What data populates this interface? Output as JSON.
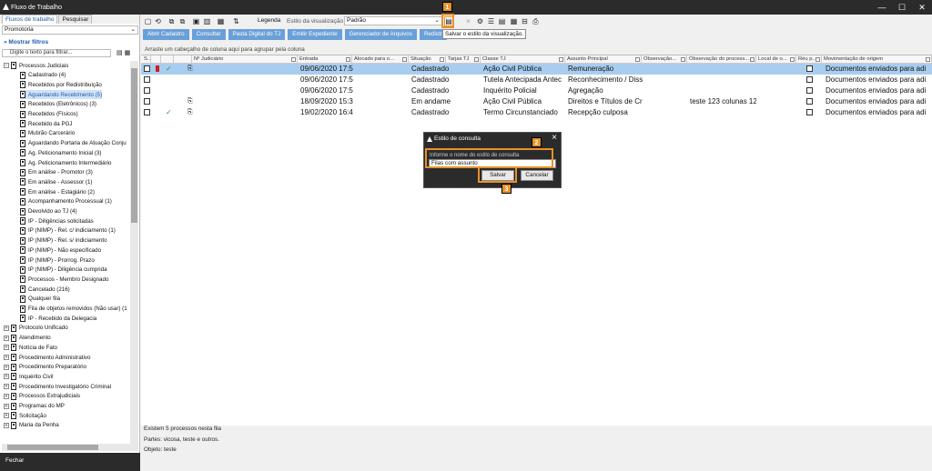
{
  "window": {
    "title": "Fluxo de Trabalho",
    "controls": [
      "—",
      "☐",
      "✕"
    ]
  },
  "left": {
    "tabs": [
      "Fluxos de trabalho",
      "Pesquisar"
    ],
    "combo_value": "Promotoria",
    "mostrar_filtros": "Mostrar filtros",
    "filter_placeholder": "Digite o texto para filtrar...",
    "tree": [
      {
        "label": "Processos Judiciais",
        "level": 0,
        "exp": "−"
      },
      {
        "label": "Cadastrado (4)",
        "level": 1
      },
      {
        "label": "Recebidos por Redistribuição",
        "level": 1
      },
      {
        "label": "Aguardando Recebimento (5)",
        "level": 1,
        "selected": true
      },
      {
        "label": "Recebidos (Eletrônicos) (3)",
        "level": 1
      },
      {
        "label": "Recebidos (Físicos)",
        "level": 1
      },
      {
        "label": "Recebido da PGJ",
        "level": 1
      },
      {
        "label": "Mutirão Carcerário",
        "level": 1
      },
      {
        "label": "Aguardando Portaria de Atuação Conju",
        "level": 1
      },
      {
        "label": "Ag. Peticionamento Inicial (3)",
        "level": 1
      },
      {
        "label": "Ag. Peticionamento Intermediário",
        "level": 1
      },
      {
        "label": "Em análise - Promotor (3)",
        "level": 1
      },
      {
        "label": "Em análise - Assessor (1)",
        "level": 1
      },
      {
        "label": "Em análise - Estagiário (2)",
        "level": 1
      },
      {
        "label": "Acompanhamento Processual (1)",
        "level": 1
      },
      {
        "label": "Devolvido ao TJ (4)",
        "level": 1
      },
      {
        "label": "IP - Diligências solicitadas",
        "level": 1
      },
      {
        "label": "IP (NIMP) - Rel. c/ indiciamento (1)",
        "level": 1
      },
      {
        "label": "IP (NIMP) - Rel. s/ indiciamento",
        "level": 1
      },
      {
        "label": "IP (NIMP) - Não especificado",
        "level": 1
      },
      {
        "label": "IP (NIMP) - Prorrog. Prazo",
        "level": 1
      },
      {
        "label": "IP (NIMP) - Diligência cumprida",
        "level": 1
      },
      {
        "label": "Processos - Membro Designado",
        "level": 1
      },
      {
        "label": "Cancelado (216)",
        "level": 1
      },
      {
        "label": "Qualquer fila",
        "level": 1
      },
      {
        "label": "Fila de objetos removidos (Não usar) (1",
        "level": 1
      },
      {
        "label": "IP - Recebido da Delegacia",
        "level": 1
      },
      {
        "label": "Protocolo Unificado",
        "level": 0,
        "exp": "+"
      },
      {
        "label": "Atendimento",
        "level": 0,
        "exp": "+"
      },
      {
        "label": "Notícia de Fato",
        "level": 0,
        "exp": "+"
      },
      {
        "label": "Procedimento Administrativo",
        "level": 0,
        "exp": "+"
      },
      {
        "label": "Procedimento Preparatório",
        "level": 0,
        "exp": "+"
      },
      {
        "label": "Inquérito Civil",
        "level": 0,
        "exp": "+"
      },
      {
        "label": "Procedimento Investigatório Criminal",
        "level": 0,
        "exp": "+"
      },
      {
        "label": "Processos Extrajudiciais",
        "level": 0,
        "exp": "+"
      },
      {
        "label": "Programas do MP",
        "level": 0,
        "exp": "+"
      },
      {
        "label": "Solicitação",
        "level": 0,
        "exp": "+"
      },
      {
        "label": "Maria da Penha",
        "level": 0,
        "exp": "+"
      }
    ],
    "fechar": "Fechar"
  },
  "toolbar": {
    "legenda": "Legenda",
    "estilo_label": "Estilo da visualização",
    "estilo_value": "Padrão",
    "tooltip": "Salvar o estilo da visualização."
  },
  "actions": [
    "Abrir Cadastro",
    "Consultar",
    "Pasta Digital do TJ",
    "Emitir Expediente",
    "Gerenciador de Arquivos",
    "Redistr"
  ],
  "grid": {
    "group_hint": "Arraste um cabeçalho de coluna aqui para agrupar pela coluna",
    "headers": [
      "S...",
      "",
      "",
      "",
      "Nº Judiciário",
      "Entrada",
      "Alocado para o...",
      "Situação",
      "Tarjas TJ",
      "Classe TJ",
      "Assunto Principal",
      "Observação...",
      "Observação do process...",
      "Local de o...",
      "Réu p...",
      "Movimentação de origem"
    ],
    "rows": [
      {
        "entrada": "09/06/2020 17:5",
        "situacao": "Cadastrado",
        "classe": "Ação Civil Pública",
        "assunto": "Remuneração",
        "obs": "",
        "mov": "Documentos enviados para adi",
        "selected": true,
        "flag": true,
        "check": true,
        "clip": true
      },
      {
        "entrada": "09/06/2020 17:5",
        "situacao": "Cadastrado",
        "classe": "Tutela Antecipada Antec",
        "assunto": "Reconhecimento / Diss",
        "obs": "",
        "mov": "Documentos enviados para adi"
      },
      {
        "entrada": "09/06/2020 17:5",
        "situacao": "Cadastrado",
        "classe": "Inquérito Policial",
        "assunto": "Agregação",
        "obs": "",
        "mov": "Documentos enviados para adi"
      },
      {
        "entrada": "18/09/2020 15:3",
        "situacao": "Em andame",
        "classe": "Ação Civil Pública",
        "assunto": "Direitos e Títulos de Cr",
        "obs": "teste 123  colunas 12",
        "mov": "Documentos enviados para adi",
        "clip": true
      },
      {
        "entrada": "19/02/2020 16:4",
        "situacao": "Cadastrado",
        "classe": "Termo Circunstanciado",
        "assunto": "Recepção culposa",
        "obs": "",
        "mov": "Documentos enviados para adi",
        "check": true,
        "clip": true
      }
    ]
  },
  "status": {
    "line1": "Existem 5 processos nesta fila",
    "line2": "Partes: vicosa, teste e outros.",
    "line3": "Objeto: teste"
  },
  "dialog": {
    "title": "Estilo de consulta",
    "label": "Informe o nome do estilo de consulta",
    "value": "Filas com assunto",
    "save": "Salvar",
    "cancel": "Cancelar"
  },
  "badges": [
    "1",
    "2",
    "3"
  ],
  "colors": {
    "accent": "#e8912a",
    "selection": "#a9cdef",
    "button": "#6aa0d8",
    "titlebar": "#2b2b2b"
  }
}
